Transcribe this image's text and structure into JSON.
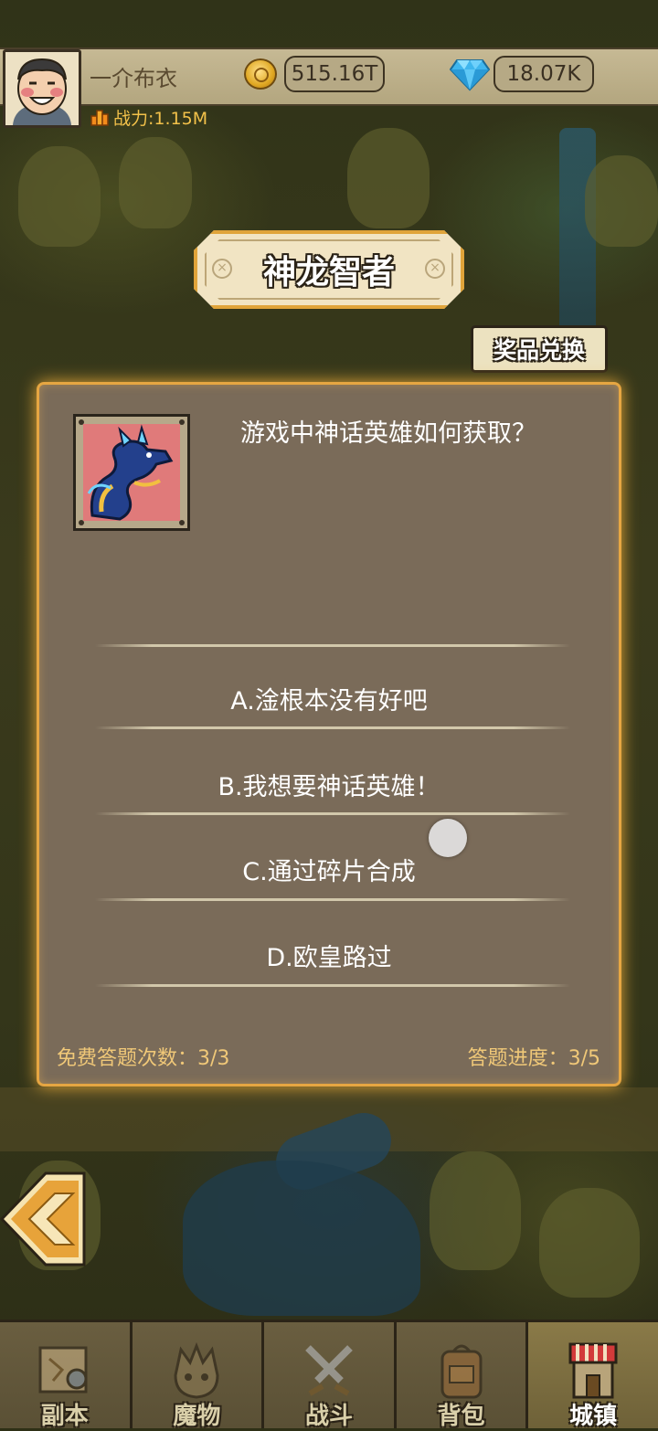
{
  "player": {
    "name": "一介布衣",
    "power_label": "战力:1.15M",
    "coins": "515.16T",
    "gems": "18.07K"
  },
  "page": {
    "title": "神龙智者",
    "exchange_button": "奖品兑换"
  },
  "quiz": {
    "question": "游戏中神话英雄如何获取？",
    "options": [
      {
        "label": "A.淦根本没有好吧"
      },
      {
        "label": "B.我想要神话英雄！"
      },
      {
        "label": "C.通过碎片合成"
      },
      {
        "label": "D.欧皇路过"
      }
    ],
    "free_attempts": "免费答题次数：3/3",
    "progress": "答题进度：3/5"
  },
  "nav": {
    "tabs": [
      {
        "label": "副本",
        "icon": "map-icon",
        "active": false
      },
      {
        "label": "魔物",
        "icon": "monster-icon",
        "active": false
      },
      {
        "label": "战斗",
        "icon": "crossed-swords-icon",
        "active": false
      },
      {
        "label": "背包",
        "icon": "backpack-icon",
        "active": false
      },
      {
        "label": "城镇",
        "icon": "town-icon",
        "active": true
      }
    ]
  },
  "colors": {
    "panel_border": "#e6a642",
    "currency_text": "#3a3022",
    "footer_text": "#f0c878",
    "power_text": "#f2c14a"
  }
}
